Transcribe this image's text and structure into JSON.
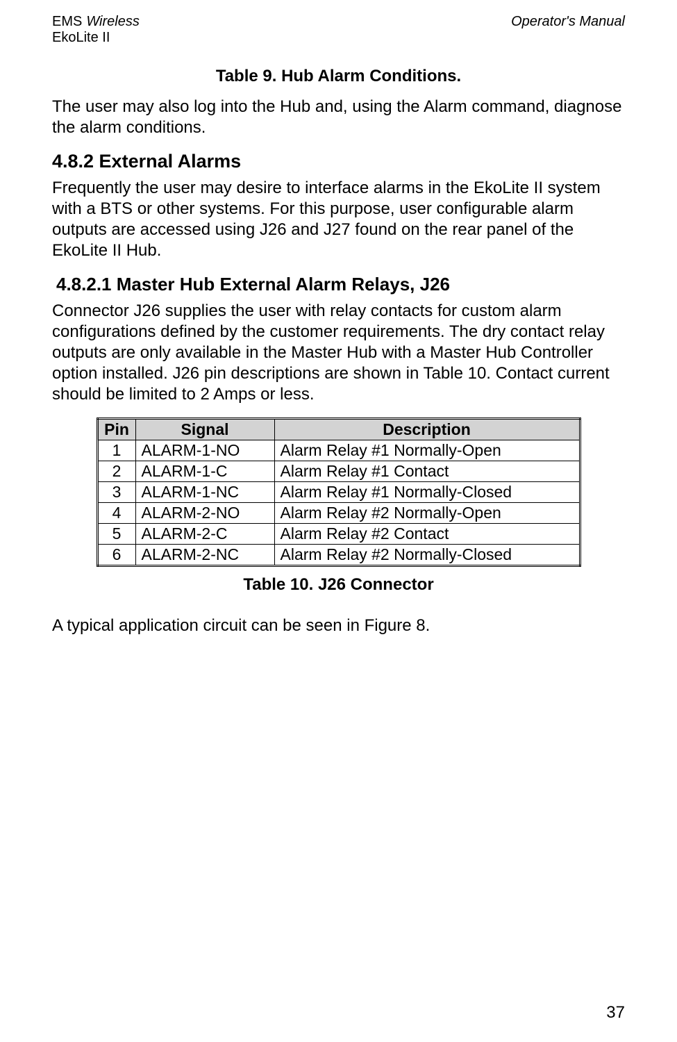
{
  "header": {
    "ems": "EMS",
    "wireless": "Wireless",
    "ekolite": "EkoLite II",
    "right": "Operator's Manual"
  },
  "table9_caption": "Table 9.  Hub Alarm Conditions.",
  "para1": "The user may also log into the Hub and, using the Alarm command, diagnose the alarm conditions.",
  "section_482": "4.8.2  External Alarms",
  "para2": "Frequently the user may desire to interface alarms in the EkoLite II system with a BTS or other systems.  For this purpose, user configurable alarm outputs are accessed using J26 and J27 found on the rear panel of the EkoLite II Hub.",
  "section_4821": "4.8.2.1   Master Hub External Alarm Relays, J26",
  "para3": "Connector J26 supplies the user with relay contacts for custom alarm configurations defined by the customer requirements.  The dry contact relay outputs are only available in the Master Hub with a Master Hub Controller option installed.   J26 pin descriptions are shown in Table 10.  Contact current should be limited to 2 Amps or less.",
  "table10": {
    "headers": {
      "pin": "Pin",
      "signal": "Signal",
      "description": "Description"
    },
    "rows": [
      {
        "pin": "1",
        "signal": "ALARM-1-NO",
        "description": "Alarm Relay #1 Normally-Open"
      },
      {
        "pin": "2",
        "signal": "ALARM-1-C",
        "description": "Alarm Relay #1 Contact"
      },
      {
        "pin": "3",
        "signal": "ALARM-1-NC",
        "description": "Alarm Relay #1 Normally-Closed"
      },
      {
        "pin": "4",
        "signal": "ALARM-2-NO",
        "description": "Alarm Relay #2 Normally-Open"
      },
      {
        "pin": "5",
        "signal": "ALARM-2-C",
        "description": "Alarm Relay #2 Contact"
      },
      {
        "pin": "6",
        "signal": "ALARM-2-NC",
        "description": "Alarm Relay #2 Normally-Closed"
      }
    ]
  },
  "table10_caption": "Table 10.  J26 Connector",
  "para4": "A typical application circuit can be seen in Figure 8.",
  "page_number": "37"
}
